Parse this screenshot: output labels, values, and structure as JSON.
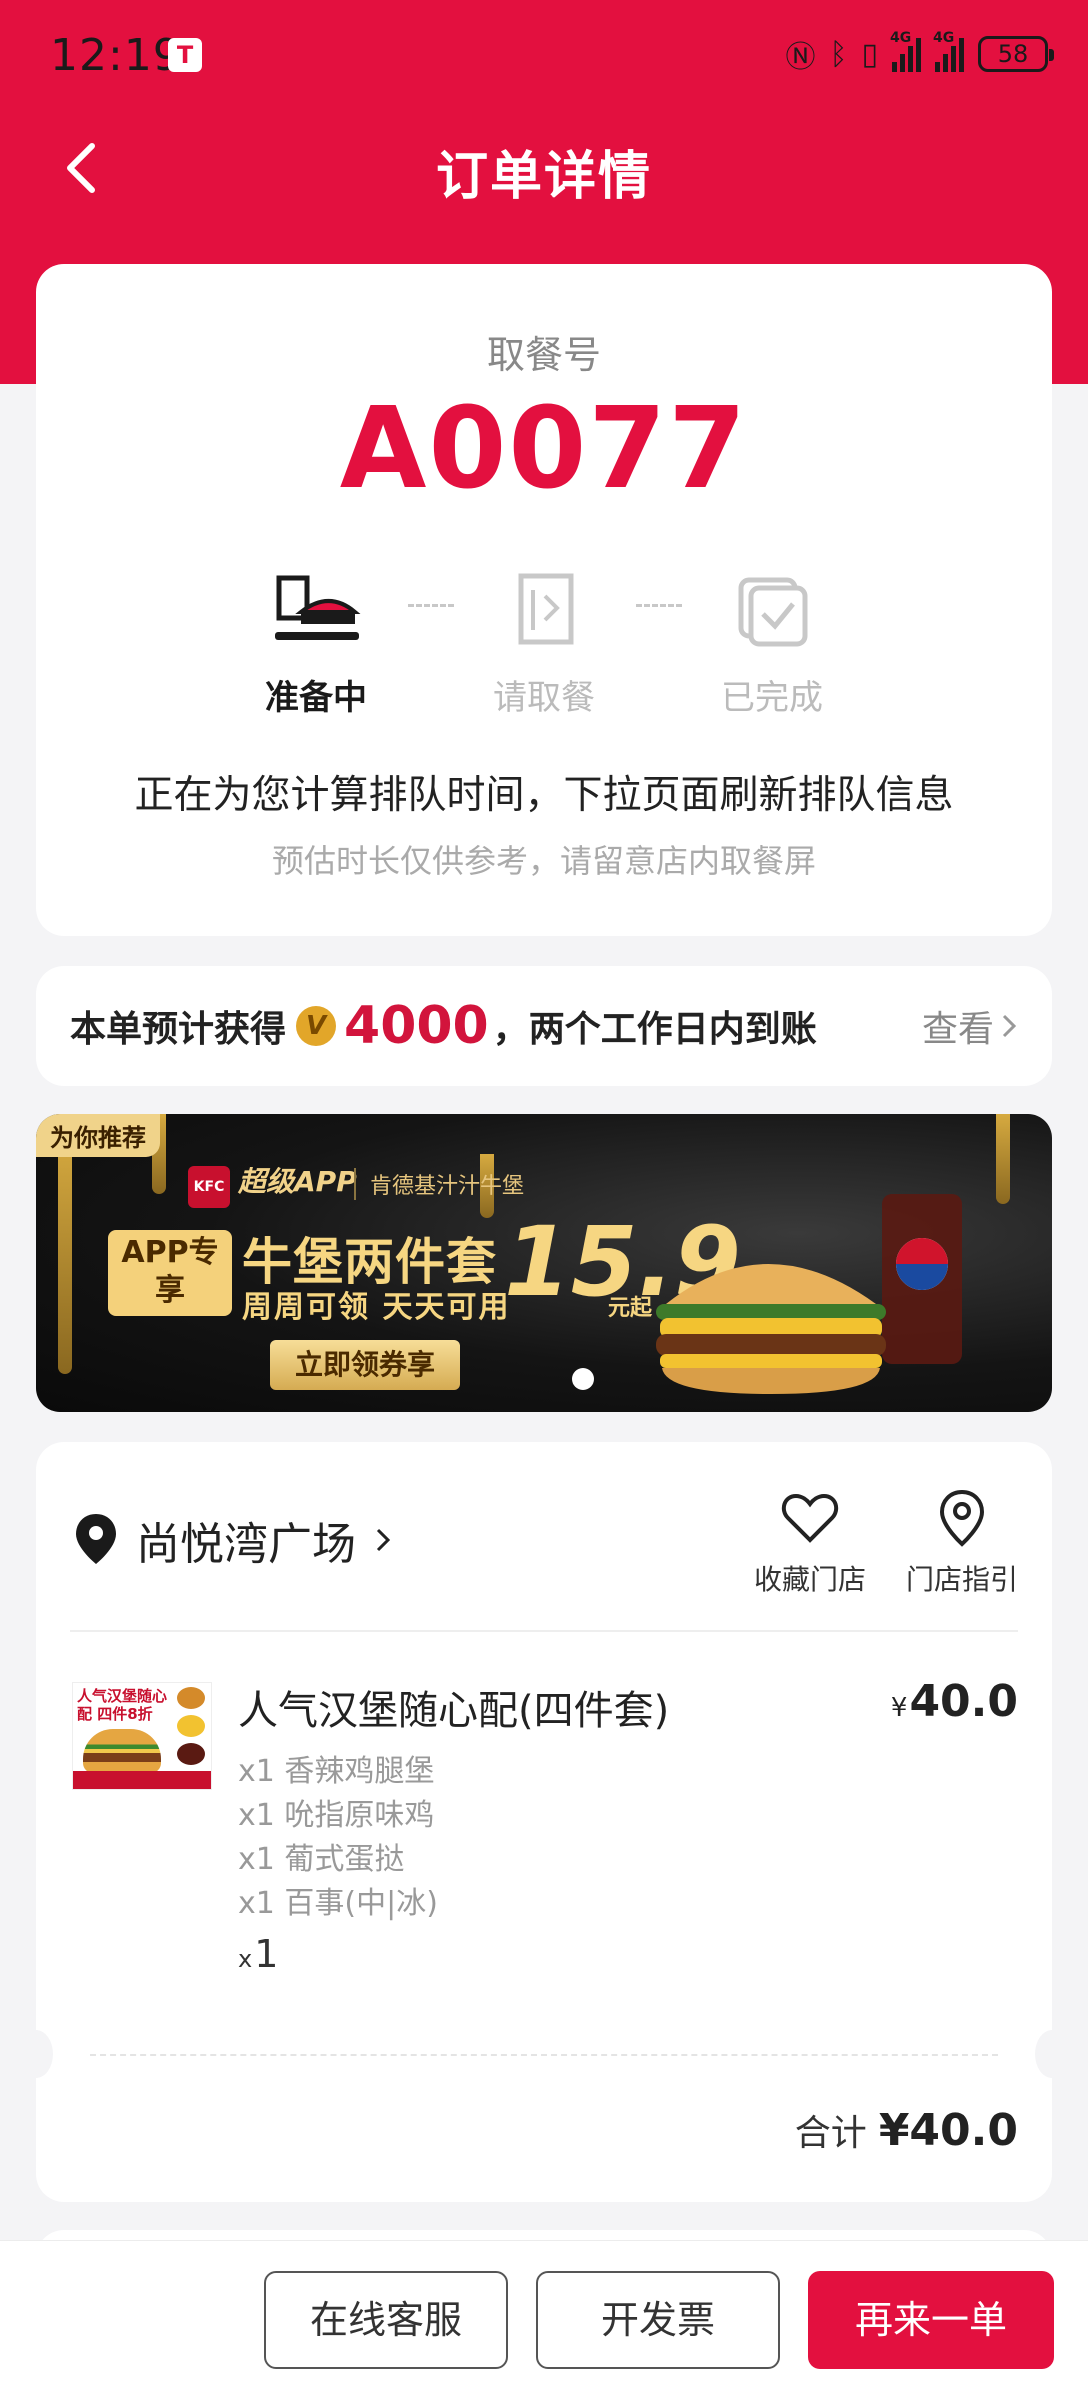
{
  "status_bar": {
    "time": "12:19",
    "battery": "58",
    "network": [
      "4G",
      "4G"
    ]
  },
  "header": {
    "title": "订单详情",
    "back_icon": "chevron-left-icon"
  },
  "pickup": {
    "label": "取餐号",
    "number": "A0077",
    "steps": [
      {
        "label": "准备中",
        "icon": "tray-meal-icon",
        "active": true
      },
      {
        "label": "请取餐",
        "icon": "receipt-icon",
        "active": false
      },
      {
        "label": "已完成",
        "icon": "checked-bag-icon",
        "active": false
      }
    ],
    "queue_message": "正在为您计算排队时间，下拉页面刷新排队信息",
    "queue_note": "预估时长仅供参考，请留意店内取餐屏"
  },
  "points": {
    "prefix": "本单预计获得",
    "badge": "V",
    "value": "4000",
    "suffix": "，两个工作日内到账",
    "view_label": "查看"
  },
  "banner": {
    "tag": "为你推荐",
    "logo": "KFC",
    "app_name": "超级APP",
    "subtitle": "肯德基汁汁牛堡",
    "app_only": "APP专享",
    "headline": "牛堡两件套",
    "price": "15.9",
    "price_suffix": "元起",
    "subline": "周周可领 天天可用",
    "button": "立即领券享"
  },
  "store": {
    "name": "尚悦湾广场",
    "favorite_label": "收藏门店",
    "guide_label": "门店指引"
  },
  "order": {
    "item_name": "人气汉堡随心配(四件套)",
    "currency": "¥",
    "item_price": "40.0",
    "thumb_text": "人气汉堡随心配 四件8折",
    "sub_items": [
      "x1 香辣鸡腿堡",
      "x1 吮指原味鸡",
      "x1 葡式蛋挞",
      "x1 百事(中|冰)"
    ],
    "qty_prefix": "x",
    "qty": "1",
    "total_label": "合计",
    "total_value": "¥40.0"
  },
  "actions": {
    "service": "在线客服",
    "invoice": "开发票",
    "reorder": "再来一单"
  },
  "colors": {
    "brand_red": "#e3103f",
    "gold": "#f6d682"
  }
}
